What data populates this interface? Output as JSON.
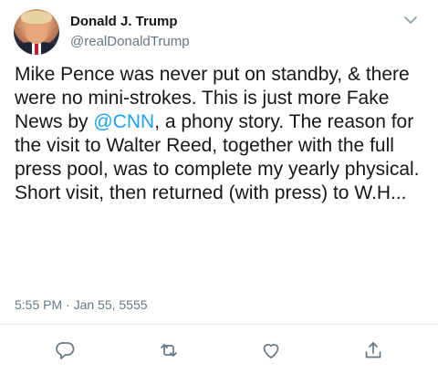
{
  "tweet": {
    "display_name": "Donald J. Trump",
    "handle": "@realDonaldTrump",
    "text_before": "Mike Pence was never put on standby, & there were no mini-strokes. This is just more Fake News by ",
    "mention": "@CNN",
    "text_after": ", a phony story. The reason for the visit to Walter Reed, together with the full press pool, was to complete my yearly physical. Short visit, then returned (with press) to W.H...",
    "timestamp": "5:55 PM · Jan 55, 5555"
  },
  "icons": {
    "menu": "chevron-down-icon",
    "reply": "reply-icon",
    "retweet": "retweet-icon",
    "like": "like-icon",
    "share": "share-icon"
  },
  "colors": {
    "mention": "#1da1f2",
    "secondary_text": "#657786",
    "icon": "#657786"
  }
}
